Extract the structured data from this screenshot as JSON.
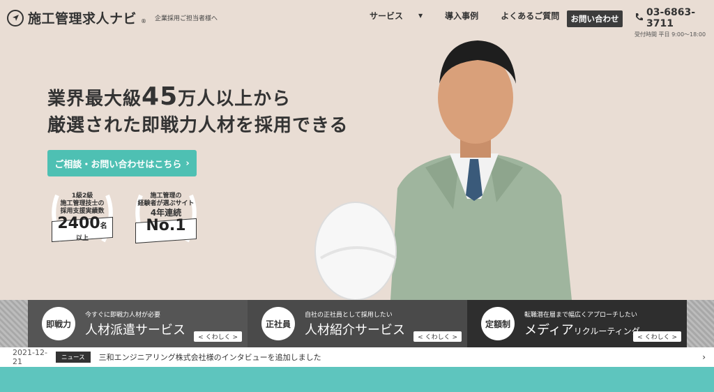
{
  "header": {
    "logo_text": "施工管理求人ナビ",
    "logo_registered": "®",
    "logo_sub": "企業採用ご担当者様へ",
    "nav": [
      {
        "label": "サービス"
      },
      {
        "label": "導入事例"
      },
      {
        "label": "よくあるご質問"
      }
    ],
    "contact_label": "お問い合わせ",
    "tel_number": "03-6863-3711",
    "tel_hours": "受付時間 平日 9:00〜18:00"
  },
  "hero": {
    "headline_1a": "業界最大級",
    "headline_1b": "45",
    "headline_1c": "万人以上から",
    "headline_2": "厳選された即戦力人材を採用できる",
    "cta_label": "ご相談・お問い合わせはこちら",
    "badge1": {
      "line1": "1級2級",
      "line2": "施工管理技士の",
      "line3": "採用支援実績数",
      "num": "2400",
      "suffix": "名",
      "extra": "以上"
    },
    "badge2": {
      "line1": "施工管理の",
      "line2": "経験者が選ぶサイト",
      "line3": "4年連続",
      "num": "No.1"
    }
  },
  "services": [
    {
      "badge": "即戦力",
      "sub": "今すぐに即戦力人材が必要",
      "title": "人材派遣サービス",
      "title_small": "",
      "more": "くわしく",
      "bg": "#555555"
    },
    {
      "badge": "正社員",
      "sub": "自社の正社員として採用したい",
      "title": "人材紹介サービス",
      "title_small": "",
      "more": "くわしく",
      "bg": "#4a4a4a"
    },
    {
      "badge": "定額制",
      "sub": "転職潜在層まで幅広くアプローチしたい",
      "title": "メディア",
      "title_small": "リクルーティング",
      "more": "くわしく",
      "bg": "#2e2e2e"
    }
  ],
  "news": {
    "date": "2021-12-21",
    "tag": "ニュース",
    "text": "三和エンジニアリング株式会社様のインタビューを追加しました"
  },
  "colors": {
    "accent": "#4ec0b3",
    "hero_bg": "#e9ddd4",
    "footer": "#5ec5be"
  }
}
